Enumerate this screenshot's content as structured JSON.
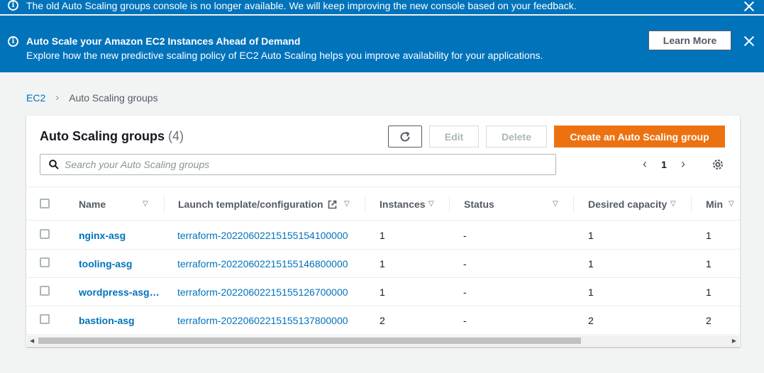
{
  "flash_notice": {
    "message": "The old Auto Scaling groups console is no longer available. We will keep improving the new console based on your feedback."
  },
  "flash_promo": {
    "title": "Auto Scale your Amazon EC2 Instances Ahead of Demand",
    "body": "Explore how the new predictive scaling policy of EC2 Auto Scaling helps you improve availability for your applications.",
    "button": "Learn More"
  },
  "breadcrumb": {
    "parent": "EC2",
    "current": "Auto Scaling groups"
  },
  "panel": {
    "title": "Auto Scaling groups",
    "count": "(4)",
    "edit": "Edit",
    "delete": "Delete",
    "create": "Create an Auto Scaling group",
    "search_placeholder": "Search your Auto Scaling groups",
    "page": "1"
  },
  "columns": {
    "name": "Name",
    "launch": "Launch template/configuration",
    "instances": "Instances",
    "status": "Status",
    "desired": "Desired capacity",
    "min": "Min"
  },
  "rows": [
    {
      "name": "nginx-asg",
      "launch": "terraform-20220602215155154100000",
      "instances": "1",
      "status": "-",
      "desired": "1",
      "min": "1"
    },
    {
      "name": "tooling-asg",
      "launch": "terraform-20220602215155146800000",
      "instances": "1",
      "status": "-",
      "desired": "1",
      "min": "1"
    },
    {
      "name": "wordpress-asg…",
      "launch": "terraform-20220602215155126700000",
      "instances": "1",
      "status": "-",
      "desired": "1",
      "min": "1"
    },
    {
      "name": "bastion-asg",
      "launch": "terraform-20220602215155137800000",
      "instances": "2",
      "status": "-",
      "desired": "2",
      "min": "2"
    }
  ],
  "colors": {
    "flash": "#0073bb",
    "primary": "#ec7211",
    "link": "#0073bb"
  }
}
